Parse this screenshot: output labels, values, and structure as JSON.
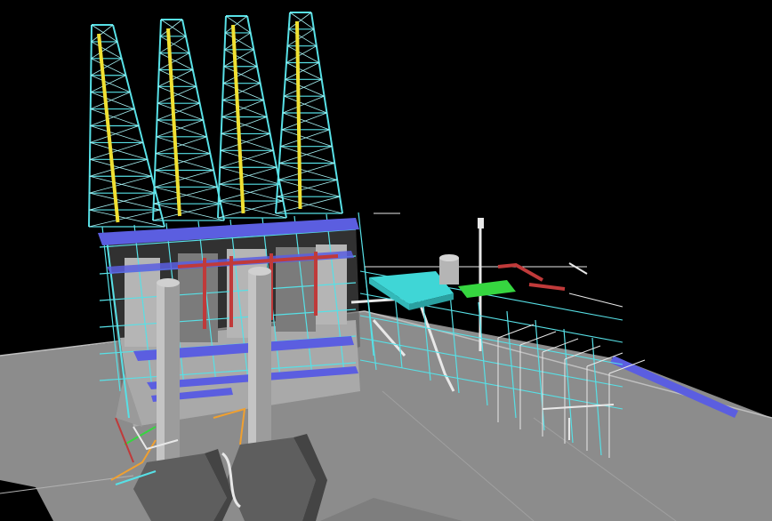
{
  "scene": {
    "subject": "",
    "colors": {
      "background": "#000000",
      "ground": "#8c8c8c",
      "ground_dark": "#6e6e6e",
      "ground_edge": "#bfbfbf",
      "steel": "#57e0e6",
      "steel_light": "#a8f3f5",
      "ladder": "#f0e032",
      "vessel": "#b5b5b5",
      "vessel_dark": "#7b7b7b",
      "duct": "#5b5ee0",
      "pipe_red": "#c03a3a",
      "tank_cyan": "#3fd6d6",
      "skid_green": "#36d640",
      "white_line": "#e8e8e8",
      "orange": "#f0a030"
    }
  }
}
